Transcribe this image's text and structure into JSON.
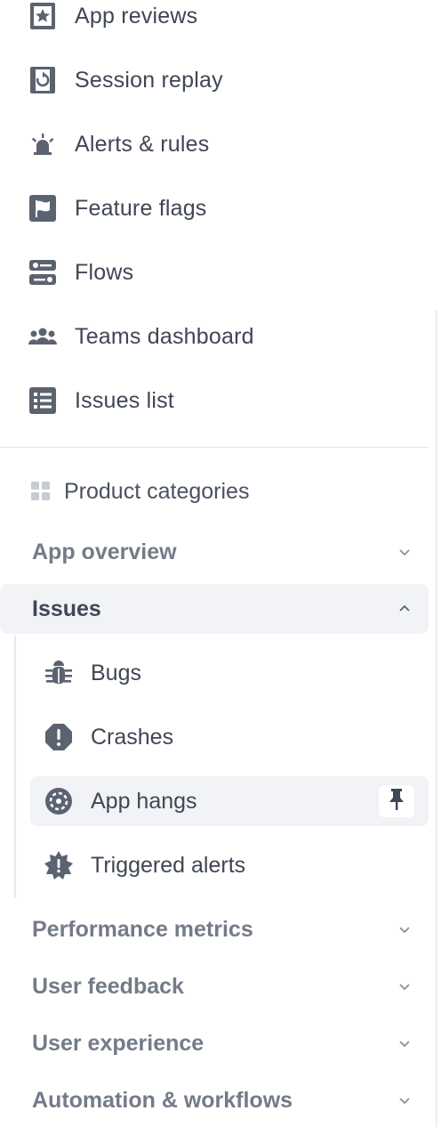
{
  "top_nav": [
    {
      "label": "App reviews",
      "icon": "star-box-icon"
    },
    {
      "label": "Session replay",
      "icon": "replay-icon"
    },
    {
      "label": "Alerts & rules",
      "icon": "siren-icon"
    },
    {
      "label": "Feature flags",
      "icon": "flag-icon"
    },
    {
      "label": "Flows",
      "icon": "flows-icon"
    },
    {
      "label": "Teams dashboard",
      "icon": "team-icon"
    },
    {
      "label": "Issues list",
      "icon": "list-icon"
    }
  ],
  "categories": {
    "label": "Product categories",
    "icon": "grid-icon"
  },
  "sections": {
    "app_overview": "App overview",
    "issues": "Issues",
    "performance_metrics": "Performance metrics",
    "user_feedback": "User feedback",
    "user_experience": "User experience",
    "automation": "Automation & workflows"
  },
  "issues_items": [
    {
      "label": "Bugs",
      "icon": "bug-icon"
    },
    {
      "label": "Crashes",
      "icon": "crash-icon"
    },
    {
      "label": "App hangs",
      "icon": "hang-icon",
      "active": true,
      "pinned": true
    },
    {
      "label": "Triggered alerts",
      "icon": "alert-burst-icon"
    }
  ],
  "colors": {
    "icon": "#5b6270",
    "active_bg": "#f1f3f6",
    "muted_text": "#747b88"
  }
}
